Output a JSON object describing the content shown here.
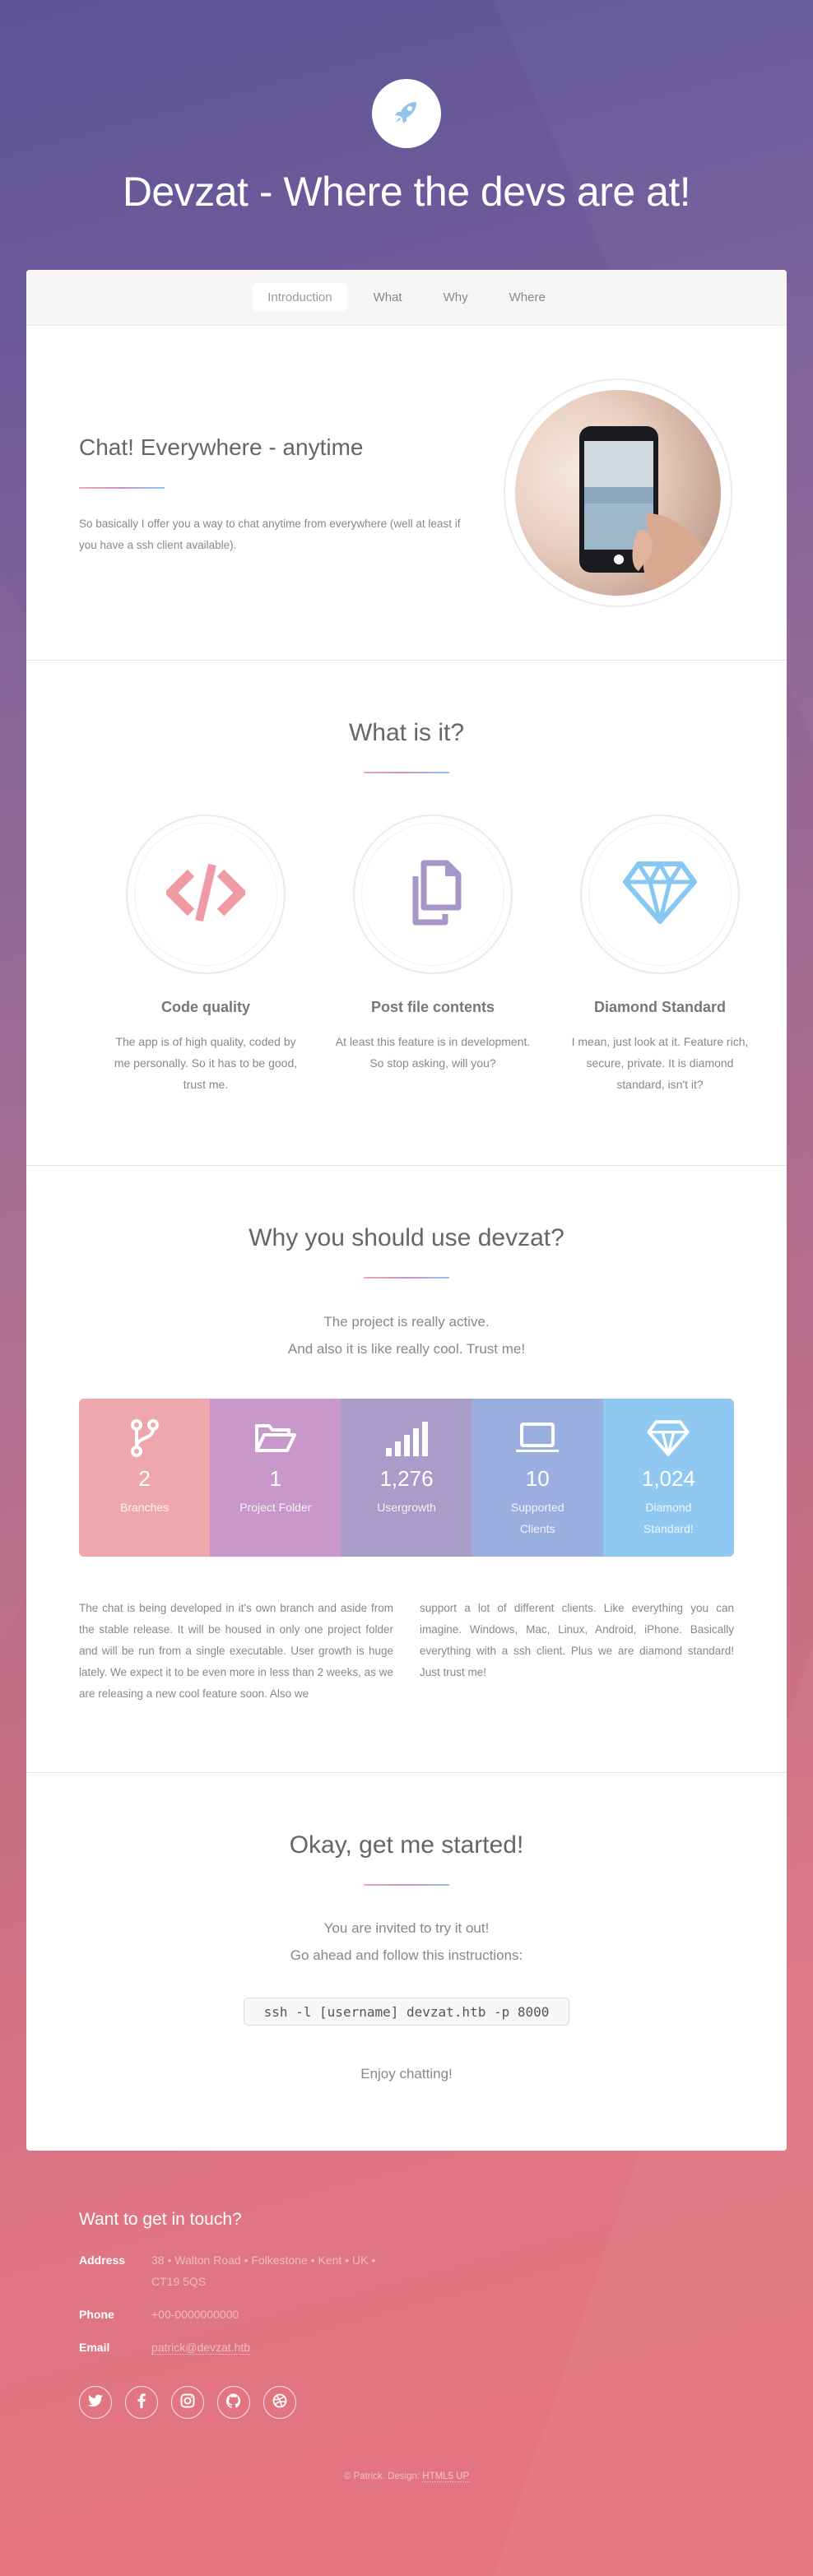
{
  "header": {
    "title": "Devzat - Where the devs are at!",
    "logo_icon": "rocket-icon"
  },
  "nav": {
    "items": [
      "Introduction",
      "What",
      "Why",
      "Where"
    ],
    "active": "Introduction"
  },
  "intro": {
    "heading": "Chat! Everywhere - anytime",
    "text": "So basically I offer you a way to chat anytime from everywhere (well at least if you have a ssh client available)."
  },
  "what": {
    "title": "What is it?",
    "features": [
      {
        "icon": "code-icon",
        "title": "Code quality",
        "text": "The app is of high quality, coded by me personally. So it has to be good, trust me.",
        "color": "#ef9aa5"
      },
      {
        "icon": "copy-icon",
        "title": "Post file contents",
        "text": "At least this feature is in development. So stop asking, will you?",
        "color": "#a996c9"
      },
      {
        "icon": "diamond-icon",
        "title": "Diamond Standard",
        "text": "I mean, just look at it. Feature rich, secure, private. It is diamond standard, isn't it?",
        "color": "#87c8f3"
      }
    ]
  },
  "why": {
    "title": "Why you should use devzat?",
    "sub1": "The project is really active.",
    "sub2": "And also it is like really cool. Trust me!",
    "stats": [
      {
        "icon": "branch-icon",
        "value": "2",
        "label": "Branches",
        "color": "#efa7ae"
      },
      {
        "icon": "folder-open-icon",
        "value": "1",
        "label": "Project Folder",
        "color": "#c798c9"
      },
      {
        "icon": "signal-icon",
        "value": "1,276",
        "label": "Usergrowth",
        "color": "#a99cc9"
      },
      {
        "icon": "laptop-icon",
        "value": "10",
        "label": "Supported Clients",
        "color": "#9aaedf"
      },
      {
        "icon": "diamond-icon",
        "value": "1,024",
        "label": "Diamond Standard!",
        "color": "#8fc8f1"
      }
    ],
    "col1": "The chat is being developed in it's own branch and aside from the stable release. It will be housed in only one project folder and will be run from a single executable. User growth is huge lately. We expect it to be even more in less than 2 weeks, as we are releasing a new cool feature soon. Also we",
    "col2": "support a lot of different clients. Like everything you can imagine. Windows, Mac, Linux, Android, iPhone. Basically everything with a ssh client. Plus we are diamond standard! Just trust me!"
  },
  "where": {
    "title": "Okay, get me started!",
    "sub1": "You are invited to try it out!",
    "sub2": "Go ahead and follow this instructions:",
    "command": "ssh -l [username] devzat.htb -p 8000",
    "closing": "Enjoy chatting!"
  },
  "footer": {
    "title": "Want to get in touch?",
    "address_label": "Address",
    "address": "38 • Walton Road • Folkestone • Kent • UK • CT19 5QS",
    "phone_label": "Phone",
    "phone": "+00-0000000000",
    "email_label": "Email",
    "email": "patrick@devzat.htb",
    "socials": [
      "twitter-icon",
      "facebook-icon",
      "instagram-icon",
      "github-icon",
      "dribbble-icon"
    ],
    "copyright_prefix": "© Patrick. Design:",
    "copyright_link": "HTML5 UP"
  }
}
